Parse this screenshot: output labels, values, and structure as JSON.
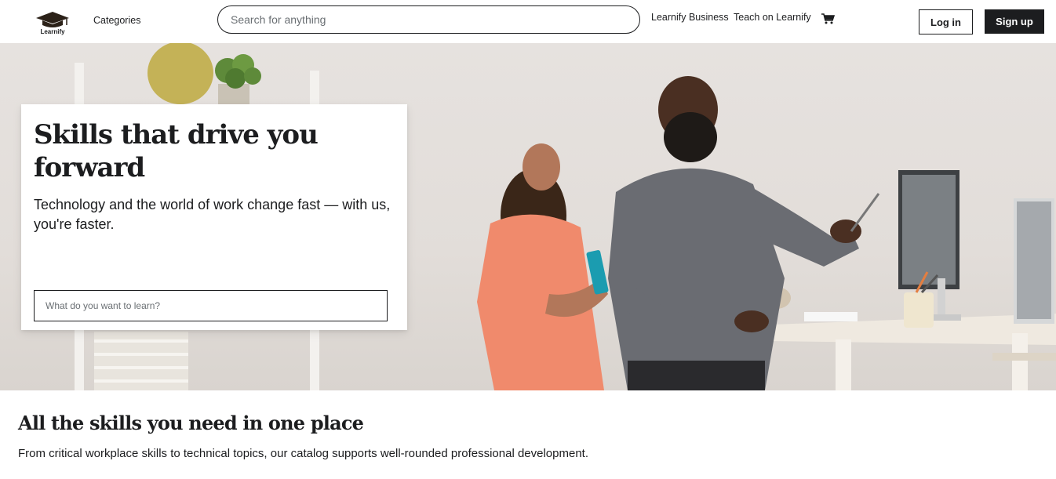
{
  "header": {
    "logo_text": "Learnify",
    "categories_label": "Categories",
    "search_placeholder": "Search for anything",
    "business_link": "Learnify Business",
    "teach_link": "Teach on Learnify",
    "cart_icon": "cart-icon",
    "login_label": "Log in",
    "signup_label": "Sign up"
  },
  "hero": {
    "title": "Skills that drive you forward",
    "subtitle": "Technology and the world of work change fast — with us, you're faster.",
    "input_placeholder": "What do you want to learn?"
  },
  "section": {
    "title": "All the skills you need in one place",
    "subtitle": "From critical workplace skills to technical topics, our catalog supports well-rounded professional development."
  },
  "colors": {
    "text": "#1c1d1f",
    "button_dark": "#1c1d1f",
    "hero_bg": "#e4e0dc"
  }
}
